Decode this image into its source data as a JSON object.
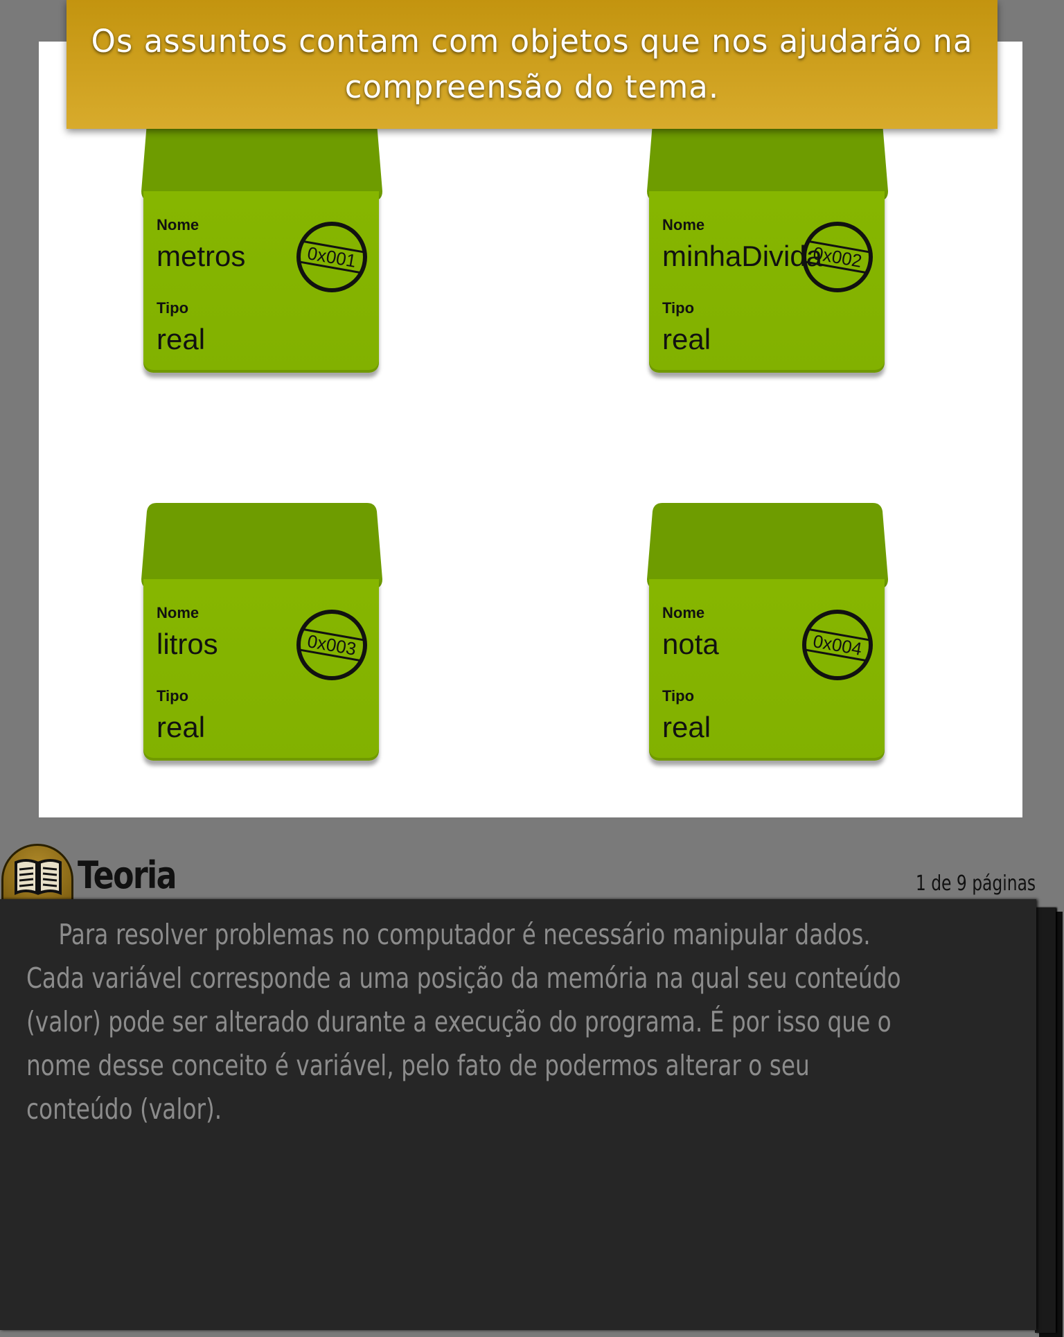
{
  "banner": {
    "text": "Os assuntos contam com objetos que nos ajudarão na compreensão do tema."
  },
  "variables": [
    {
      "name_label": "Nome",
      "name": "metros",
      "type_label": "Tipo",
      "type": "real",
      "address": "0x001"
    },
    {
      "name_label": "Nome",
      "name": "minhaDivida",
      "type_label": "Tipo",
      "type": "real",
      "address": "0x002"
    },
    {
      "name_label": "Nome",
      "name": "litros",
      "type_label": "Tipo",
      "type": "real",
      "address": "0x003"
    },
    {
      "name_label": "Nome",
      "name": "nota",
      "type_label": "Tipo",
      "type": "real",
      "address": "0x004"
    }
  ],
  "section": {
    "icon": "open-book-icon",
    "title": "Teoria",
    "page_count": "1 de 9 páginas"
  },
  "content": {
    "paragraph": "Para resolver problemas no computador é necessário manipular dados. Cada variável corresponde a uma posição da memória na qual seu conteúdo (valor) pode ser alterado durante a execução do programa. É por isso que o nome desse conceito é variável, pelo fato de podermos alterar o seu conteúdo (valor)."
  },
  "colors": {
    "banner": "#d0a222",
    "box": "#86b600",
    "box_lid": "#6e9c00",
    "panel": "#262626"
  }
}
